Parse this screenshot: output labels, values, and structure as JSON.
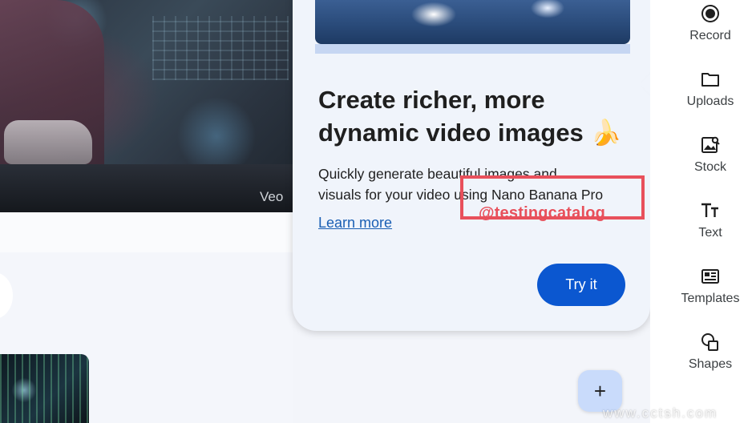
{
  "preview": {
    "hero_label": "Veo"
  },
  "popover": {
    "title_line1": "Create richer, more",
    "title_line2": "dynamic video images",
    "title_emoji": "🍌",
    "body_line1": "Quickly generate beautiful images and",
    "body_line2": "visuals for your video using Nano Banana Pro",
    "learn_more_label": "Learn more",
    "try_it_label": "Try it"
  },
  "annotation": {
    "handle": "@testingcatalog",
    "color": "#e8505b"
  },
  "sidebar": {
    "items": [
      {
        "label": "Record",
        "icon": "record-icon"
      },
      {
        "label": "Uploads",
        "icon": "folder-icon"
      },
      {
        "label": "Stock",
        "icon": "stock-image-icon"
      },
      {
        "label": "Text",
        "icon": "text-icon"
      },
      {
        "label": "Templates",
        "icon": "templates-icon"
      },
      {
        "label": "Shapes",
        "icon": "shapes-icon"
      }
    ]
  },
  "fab": {
    "label": "+"
  },
  "watermark": {
    "text": "www.cctsh.com"
  },
  "colors": {
    "accent": "#0b57d0",
    "link": "#1a5fb4",
    "popover_bg": "#f0f4fb",
    "fab_bg": "#c9dbfb"
  }
}
